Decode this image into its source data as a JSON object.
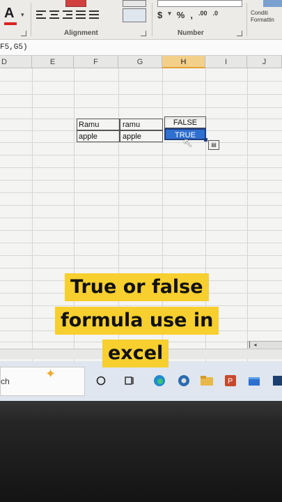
{
  "ribbon": {
    "font_color_glyph": "A",
    "alignment_label": "Alignment",
    "number_label": "Number",
    "number_buttons": [
      "$",
      "%",
      ","
    ],
    "decimal_buttons": [
      ".00",
      ".0"
    ],
    "conditional_formatting_label": "Conditi Formattin",
    "colors": {
      "font_color_bar": "#dd2222",
      "accent": "#2f6fd0"
    }
  },
  "formula_bar": {
    "text": "F5,G5)"
  },
  "columns": [
    "D",
    "E",
    "F",
    "G",
    "H",
    "I",
    "J"
  ],
  "selected_column": "H",
  "cells": {
    "f5": "Ramu",
    "g5": "ramu",
    "h5": "FALSE",
    "f6": "apple",
    "g6": "apple",
    "h6": "TRUE"
  },
  "paste_options_icon": "paste-options-icon",
  "taskbar": {
    "search_text": "ch",
    "icons": [
      "task-view-icon",
      "edge-icon",
      "chrome-icon",
      "file-explorer-icon",
      "powerpoint-icon",
      "store-icon"
    ]
  },
  "caption": {
    "line1": "True or false",
    "line2": "formula use in",
    "line3": "excel"
  }
}
